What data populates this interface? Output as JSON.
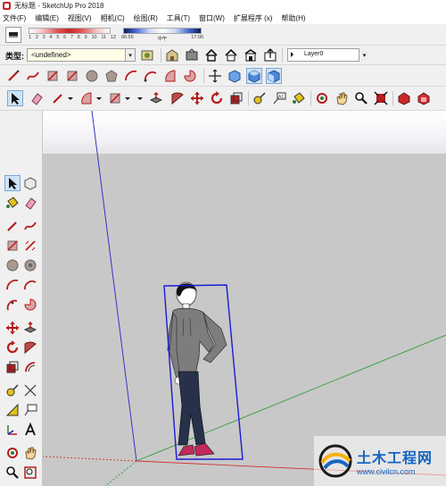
{
  "window": {
    "title": "无标题 - SketchUp Pro 2018"
  },
  "menu": [
    "文件(F)",
    "编辑(E)",
    "视图(V)",
    "相机(C)",
    "绘图(R)",
    "工具(T)",
    "窗口(W)",
    "扩展程序 (x)",
    "帮助(H)"
  ],
  "shadow": {
    "months": [
      "1",
      "2",
      "3",
      "4",
      "5",
      "6",
      "7",
      "8",
      "9",
      "10",
      "11",
      "12"
    ],
    "time_start": "06:55",
    "time_mid": "中午",
    "time_end": "17:00"
  },
  "tag_toolbar": {
    "label": "类型:",
    "value": "<undefined>",
    "layer_value": "Layer0"
  },
  "watermark": {
    "title": "土木工程网",
    "url": "www.civilcn.com"
  },
  "colors": {
    "toolbar_bg": "#f0f0f0",
    "ground": "#c8c8c8",
    "axis_red": "#d32f2f",
    "axis_green": "#2e9d3c",
    "axis_blue": "#3535c8",
    "component_box": "#1a1ad8",
    "watermark_blue": "#1565c0"
  }
}
